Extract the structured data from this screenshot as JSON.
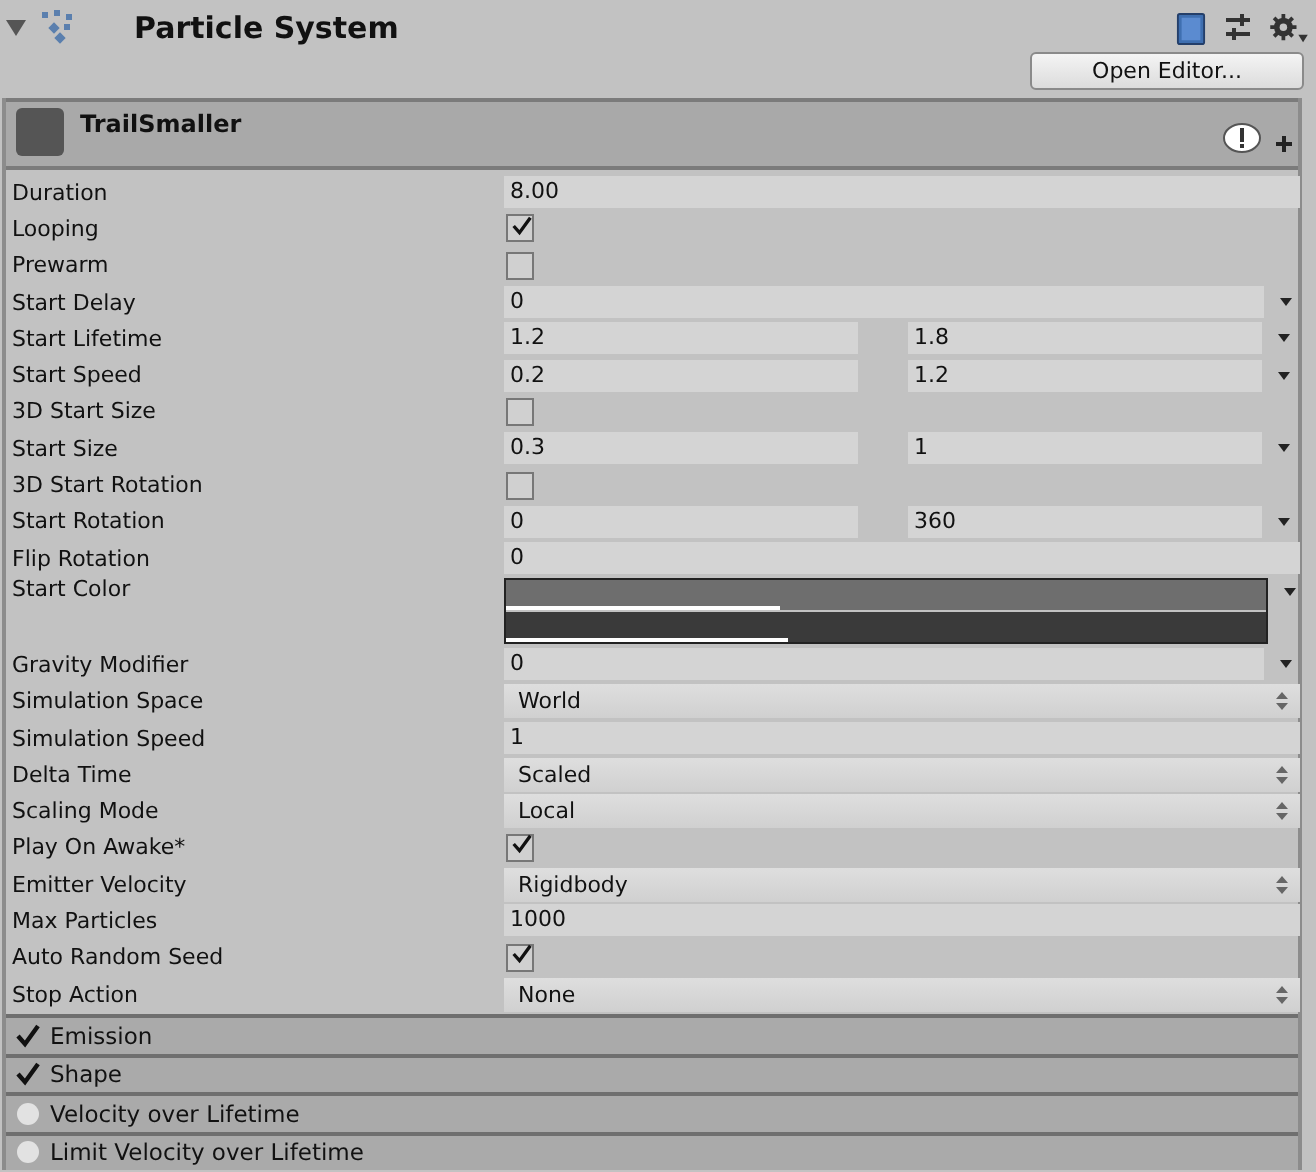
{
  "component": {
    "title": "Particle System",
    "expanded": true,
    "open_editor_button": "Open Editor..."
  },
  "main_module": {
    "name": "TrailSmaller",
    "expanded": true,
    "rows": [
      {
        "kind": "number",
        "label": "Duration",
        "value": "8.00"
      },
      {
        "kind": "checkbox",
        "label": "Looping",
        "checked": true
      },
      {
        "kind": "checkbox",
        "label": "Prewarm",
        "checked": false
      },
      {
        "kind": "curve",
        "label": "Start Delay",
        "value": "0"
      },
      {
        "kind": "range",
        "label": "Start Lifetime",
        "min": "1.2",
        "max": "1.8"
      },
      {
        "kind": "range",
        "label": "Start Speed",
        "min": "0.2",
        "max": "1.2"
      },
      {
        "kind": "checkbox",
        "label": "3D Start Size",
        "checked": false
      },
      {
        "kind": "range",
        "label": "Start Size",
        "min": "0.3",
        "max": "1"
      },
      {
        "kind": "checkbox",
        "label": "3D Start Rotation",
        "checked": false
      },
      {
        "kind": "range",
        "label": "Start Rotation",
        "min": "0",
        "max": "360"
      },
      {
        "kind": "number",
        "label": "Flip Rotation",
        "value": "0"
      },
      {
        "kind": "gradient",
        "label": "Start Color",
        "bars": [
          {
            "color": "#6e6e6e",
            "level": 0.36
          },
          {
            "color": "#3a3a3a",
            "level": 0.37
          }
        ]
      },
      {
        "kind": "curve",
        "label": "Gravity Modifier",
        "value": "0"
      },
      {
        "kind": "popup",
        "label": "Simulation Space",
        "value": "World"
      },
      {
        "kind": "number",
        "label": "Simulation Speed",
        "value": "1"
      },
      {
        "kind": "popup",
        "label": "Delta Time",
        "value": "Scaled"
      },
      {
        "kind": "popup",
        "label": "Scaling Mode",
        "value": "Local"
      },
      {
        "kind": "checkbox",
        "label": "Play On Awake*",
        "checked": true
      },
      {
        "kind": "popup",
        "label": "Emitter Velocity",
        "value": "Rigidbody"
      },
      {
        "kind": "number",
        "label": "Max Particles",
        "value": "1000"
      },
      {
        "kind": "checkbox",
        "label": "Auto Random Seed",
        "checked": true
      },
      {
        "kind": "popup",
        "label": "Stop Action",
        "value": "None"
      }
    ]
  },
  "modules": [
    {
      "name": "Emission",
      "enabled": true
    },
    {
      "name": "Shape",
      "enabled": true
    },
    {
      "name": "Velocity over Lifetime",
      "enabled": false
    },
    {
      "name": "Limit Velocity over Lifetime",
      "enabled": false
    }
  ]
}
